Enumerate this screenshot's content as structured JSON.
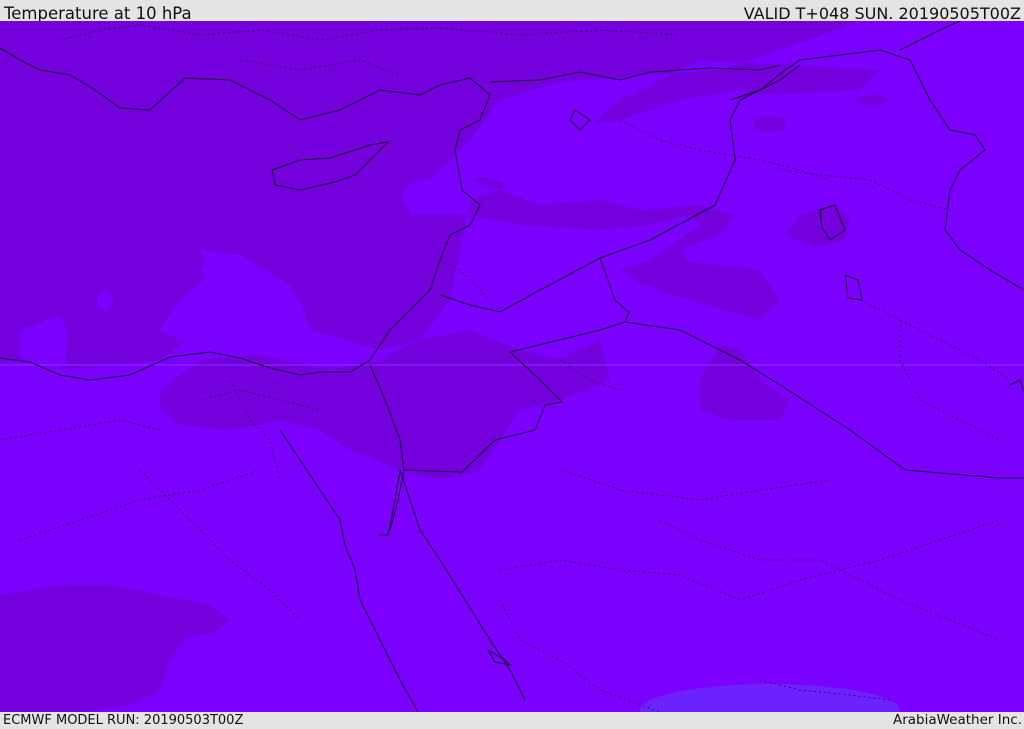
{
  "header": {
    "title": "Temperature at 10 hPa",
    "valid": "VALID T+048 SUN. 20190505T00Z"
  },
  "footer": {
    "model_run": "ECMWF MODEL RUN: 20190503T00Z",
    "credit": "ArabiaWeather Inc."
  },
  "colors": {
    "base_field": "#7b00ff",
    "cold_band": "#7300dd",
    "warm_patch": "#6b22ff",
    "borders": "#1a0030",
    "frame": "#e4e4e4"
  },
  "icons": [
    "map-coastlines",
    "country-borders"
  ]
}
